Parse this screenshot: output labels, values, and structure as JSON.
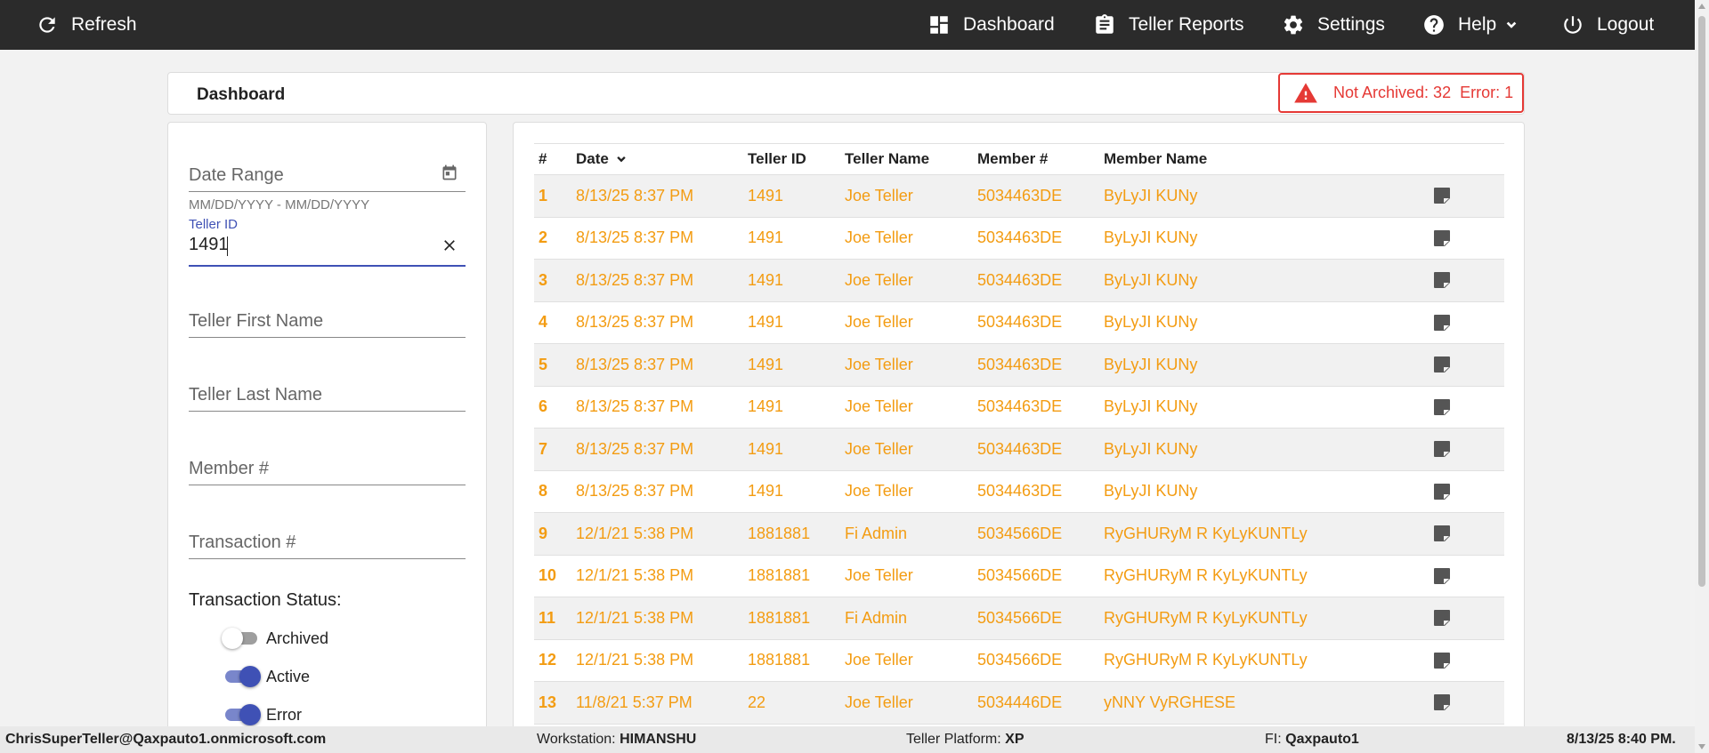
{
  "topbar": {
    "refresh_label": "Refresh",
    "nav": {
      "dashboard": "Dashboard",
      "teller_reports": "Teller Reports",
      "settings": "Settings",
      "help": "Help",
      "logout": "Logout"
    }
  },
  "dashboard": {
    "title": "Dashboard",
    "alert": {
      "not_archived": "Not Archived: 32",
      "error": "Error: 1"
    }
  },
  "filters": {
    "date_range_placeholder": "Date Range",
    "date_range_hint": "MM/DD/YYYY - MM/DD/YYYY",
    "teller_id_label": "Teller ID",
    "teller_id_value": "1491",
    "teller_first_name_placeholder": "Teller First Name",
    "teller_last_name_placeholder": "Teller Last Name",
    "member_num_placeholder": "Member #",
    "transaction_num_placeholder": "Transaction #",
    "transaction_status_title": "Transaction Status:",
    "statuses": [
      {
        "label": "Archived",
        "on": false
      },
      {
        "label": "Active",
        "on": true
      },
      {
        "label": "Error",
        "on": true
      }
    ]
  },
  "table": {
    "columns": [
      "#",
      "Date",
      "Teller ID",
      "Teller Name",
      "Member #",
      "Member Name"
    ],
    "sort_icon": "chevron-down-icon",
    "row_icon": "note-icon",
    "rows": [
      {
        "num": "1",
        "date": "8/13/25 8:37 PM",
        "teller_id": "1491",
        "teller_name": "Joe Teller",
        "member_num": "5034463DE",
        "member_name": "ByLyJI KUNy"
      },
      {
        "num": "2",
        "date": "8/13/25 8:37 PM",
        "teller_id": "1491",
        "teller_name": "Joe Teller",
        "member_num": "5034463DE",
        "member_name": "ByLyJI KUNy"
      },
      {
        "num": "3",
        "date": "8/13/25 8:37 PM",
        "teller_id": "1491",
        "teller_name": "Joe Teller",
        "member_num": "5034463DE",
        "member_name": "ByLyJI KUNy"
      },
      {
        "num": "4",
        "date": "8/13/25 8:37 PM",
        "teller_id": "1491",
        "teller_name": "Joe Teller",
        "member_num": "5034463DE",
        "member_name": "ByLyJI KUNy"
      },
      {
        "num": "5",
        "date": "8/13/25 8:37 PM",
        "teller_id": "1491",
        "teller_name": "Joe Teller",
        "member_num": "5034463DE",
        "member_name": "ByLyJI KUNy"
      },
      {
        "num": "6",
        "date": "8/13/25 8:37 PM",
        "teller_id": "1491",
        "teller_name": "Joe Teller",
        "member_num": "5034463DE",
        "member_name": "ByLyJI KUNy"
      },
      {
        "num": "7",
        "date": "8/13/25 8:37 PM",
        "teller_id": "1491",
        "teller_name": "Joe Teller",
        "member_num": "5034463DE",
        "member_name": "ByLyJI KUNy"
      },
      {
        "num": "8",
        "date": "8/13/25 8:37 PM",
        "teller_id": "1491",
        "teller_name": "Joe Teller",
        "member_num": "5034463DE",
        "member_name": "ByLyJI KUNy"
      },
      {
        "num": "9",
        "date": "12/1/21 5:38 PM",
        "teller_id": "1881881",
        "teller_name": "Fi Admin",
        "member_num": "5034566DE",
        "member_name": "RyGHURyM R KyLyKUNTLy"
      },
      {
        "num": "10",
        "date": "12/1/21 5:38 PM",
        "teller_id": "1881881",
        "teller_name": "Joe Teller",
        "member_num": "5034566DE",
        "member_name": "RyGHURyM R KyLyKUNTLy"
      },
      {
        "num": "11",
        "date": "12/1/21 5:38 PM",
        "teller_id": "1881881",
        "teller_name": "Fi Admin",
        "member_num": "5034566DE",
        "member_name": "RyGHURyM R KyLyKUNTLy"
      },
      {
        "num": "12",
        "date": "12/1/21 5:38 PM",
        "teller_id": "1881881",
        "teller_name": "Joe Teller",
        "member_num": "5034566DE",
        "member_name": "RyGHURyM R KyLyKUNTLy"
      },
      {
        "num": "13",
        "date": "11/8/21 5:37 PM",
        "teller_id": "22",
        "teller_name": "Joe Teller",
        "member_num": "5034446DE",
        "member_name": "yNNY VyRGHESE"
      }
    ]
  },
  "footer": {
    "user": "ChrisSuperTeller@Qaxpauto1.onmicrosoft.com",
    "workstation_label": "Workstation:",
    "workstation_value": "HIMANSHU",
    "platform_label": "Teller Platform:",
    "platform_value": "XP",
    "fi_label": "FI:",
    "fi_value": "Qaxpauto1",
    "datetime": "8/13/25 8:40 PM."
  },
  "colors": {
    "topbar_bg": "#2b2b2b",
    "row_text": "#f39c12",
    "alert": "#e53935",
    "accent": "#3f51b5"
  }
}
